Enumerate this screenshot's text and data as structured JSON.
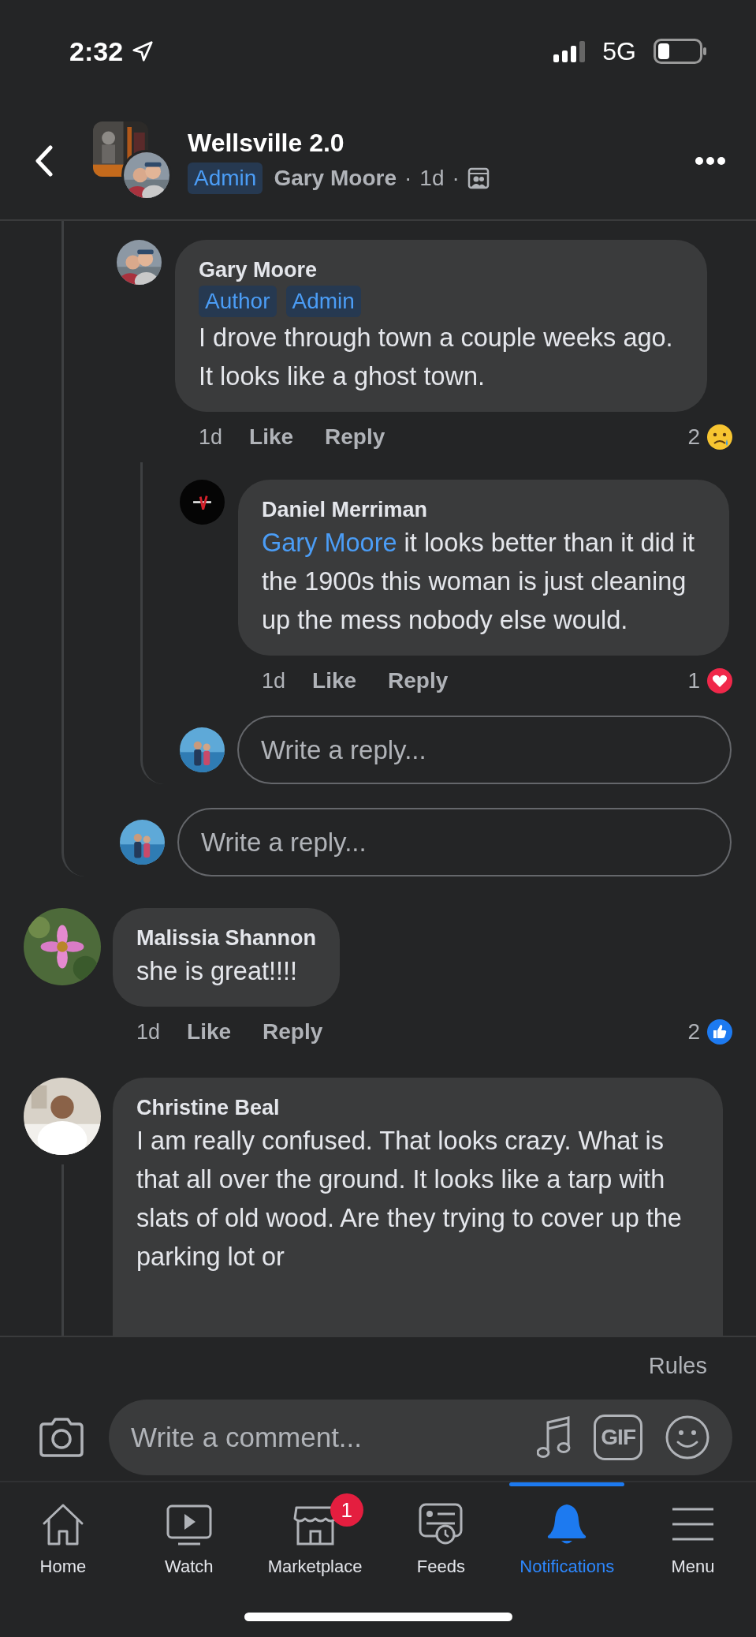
{
  "status_bar": {
    "time": "2:32",
    "network": "5G"
  },
  "header": {
    "group_name": "Wellsville 2.0",
    "badge": "Admin",
    "author": "Gary Moore",
    "separator_1": "·",
    "time": "1d",
    "separator_2": "·"
  },
  "thread": {
    "comment": {
      "name": "Gary Moore",
      "badges": [
        "Author",
        "Admin"
      ],
      "text": "I drove through town a couple weeks ago. It looks like a ghost town.",
      "time": "1d",
      "like": "Like",
      "reply": "Reply",
      "reaction": {
        "kind": "sad",
        "count": "2"
      }
    },
    "replies": [
      {
        "name": "Daniel Merriman",
        "mention": "Gary Moore",
        "text": "it looks better than it did it the 1900s this woman is just cleaning up the mess nobody else would.",
        "time": "1d",
        "like": "Like",
        "reply": "Reply",
        "reaction": {
          "kind": "love",
          "count": "1"
        }
      }
    ],
    "reply_field": {
      "placeholder": "Write a reply..."
    }
  },
  "reply_field": {
    "placeholder": "Write a reply..."
  },
  "comments": [
    {
      "name": "Malissia Shannon",
      "text": "she is great!!!!",
      "time": "1d",
      "like": "Like",
      "reply": "Reply",
      "reaction": {
        "kind": "like",
        "count": "2"
      }
    },
    {
      "name": "Christine Beal",
      "text": "I am really confused. That looks crazy. What is that all over the ground. It looks like a tarp with slats of old wood. Are they trying to cover up the parking lot or"
    }
  ],
  "composer": {
    "rules": "Rules",
    "placeholder": "Write a comment...",
    "gif_label": "GIF"
  },
  "tabs": [
    {
      "label": "Home",
      "selected": false
    },
    {
      "label": "Watch",
      "selected": false
    },
    {
      "label": "Marketplace",
      "selected": false,
      "badge": "1"
    },
    {
      "label": "Feeds",
      "selected": false
    },
    {
      "label": "Notifications",
      "selected": true
    },
    {
      "label": "Menu",
      "selected": false
    }
  ]
}
